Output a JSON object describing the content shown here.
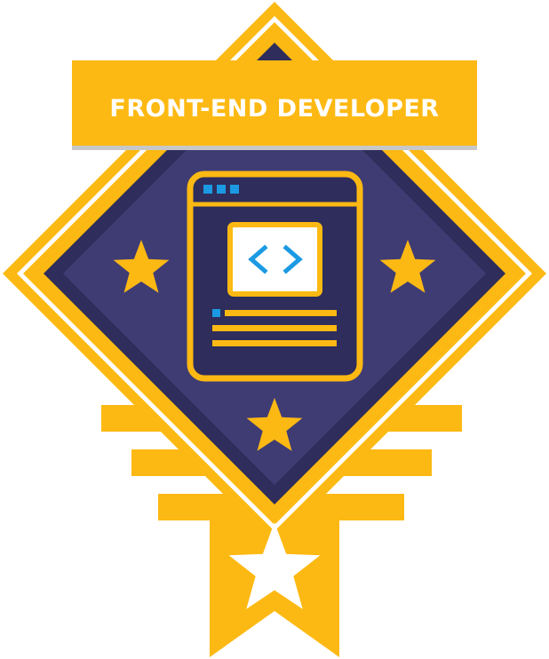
{
  "badge": {
    "title": "FRONT-END DEVELOPER",
    "code_symbol": "< >",
    "icons": {
      "window": "browser-window-icon",
      "code": "code-brackets-icon",
      "star": "star-icon"
    },
    "colors": {
      "gold": "#FDB913",
      "navy": "#2E2D5B",
      "purple": "#3F3C74",
      "white": "#FFFFFF",
      "blue": "#1B9AE3",
      "banner_shadow": "#C8C8C8"
    }
  }
}
